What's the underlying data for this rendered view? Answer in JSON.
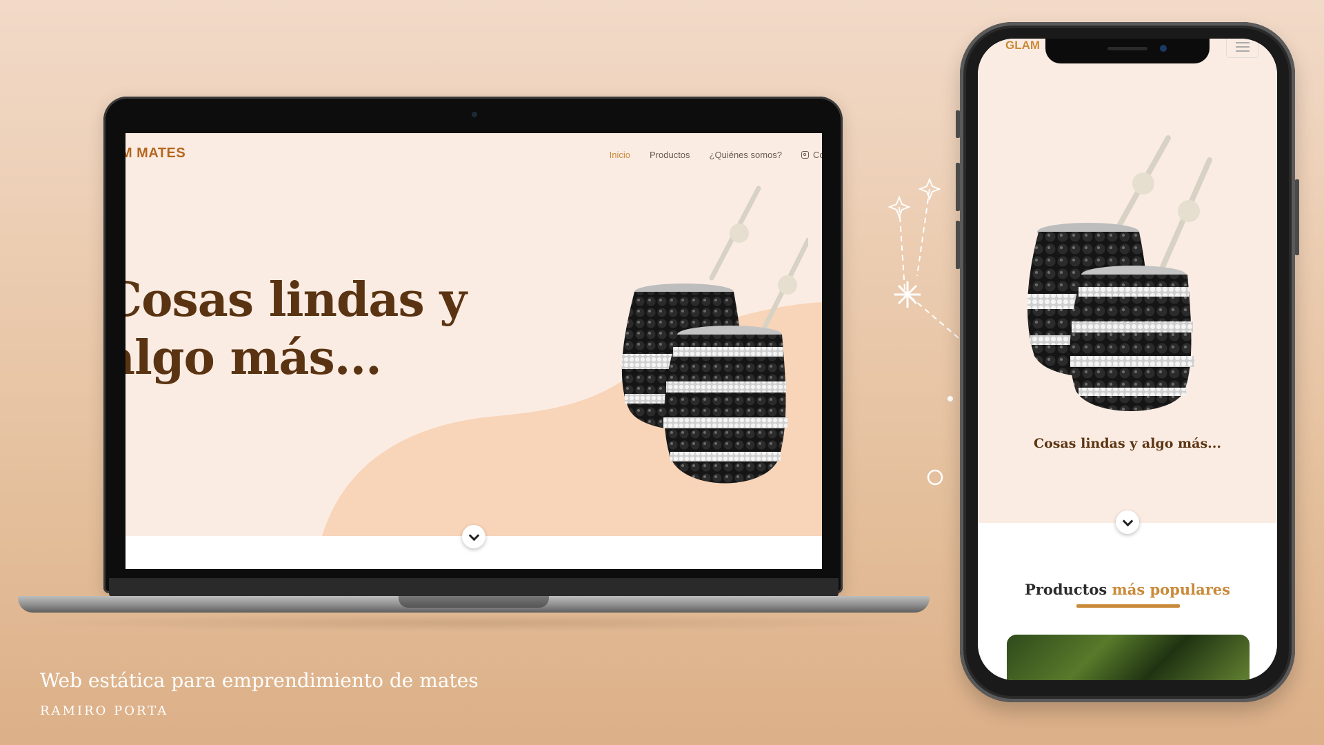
{
  "laptop_site": {
    "logo": "AM MATES",
    "nav": [
      {
        "label": "Inicio",
        "active": true
      },
      {
        "label": "Productos",
        "active": false
      },
      {
        "label": "¿Quiénes somos?",
        "active": false
      },
      {
        "label": "Cor",
        "active": false,
        "icon": "instagram-icon"
      }
    ],
    "hero_title": "Cosas lindas y\nalgo más...",
    "scroll_icon": "chevron-down-icon"
  },
  "phone_site": {
    "logo": "GLAM",
    "menu_icon": "hamburger-icon",
    "hero_title": "Cosas lindas y algo más...",
    "scroll_icon": "chevron-down-icon",
    "section_title_main": "Productos",
    "section_title_accent": "más populares"
  },
  "caption": {
    "title": "Web estática para emprendimiento de mates",
    "author": "RAMIRO PORTA"
  },
  "colors": {
    "brand": "#c98a3a",
    "heading": "#5a3412",
    "hero_bg": "#fbece3",
    "wave": "#f8d4b8"
  }
}
